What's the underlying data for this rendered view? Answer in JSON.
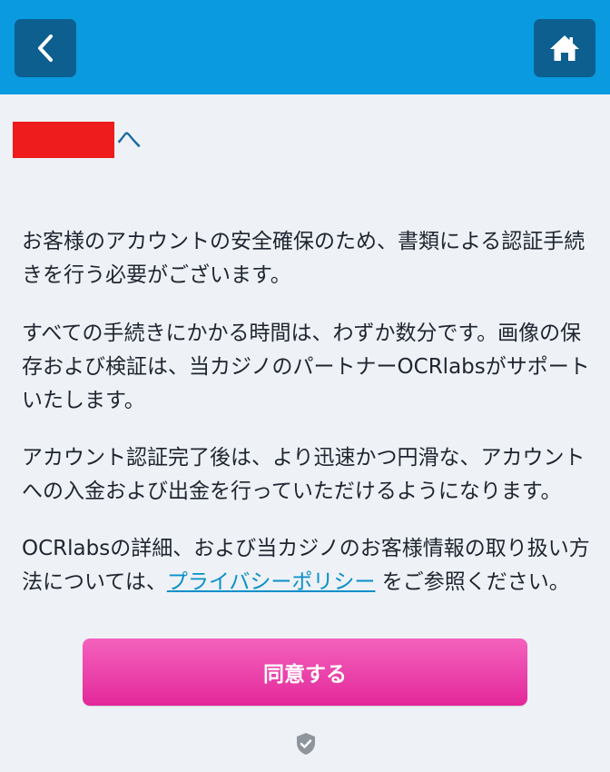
{
  "header": {
    "back_icon": "chevron-left-icon",
    "home_icon": "home-icon",
    "colors": {
      "bar": "#0a9ae0",
      "button": "#0c5f8e"
    }
  },
  "greeting": {
    "suffix": "へ",
    "redaction_color": "#ee1c1c"
  },
  "paragraphs": [
    "お客様のアカウントの安全確保のため、書類による認証手続きを行う必要がございます。",
    "すべての手続きにかかる時間は、わずか数分です。画像の保存および検証は、当カジノのパートナーOCRlabsがサポートいたします。",
    "アカウント認証完了後は、より迅速かつ円滑な、アカウントへの入金および出金を行っていただけるようになります。"
  ],
  "privacy": {
    "before": "OCRlabsの詳細、および当カジノのお客様情報の取り扱い方法については、",
    "link": "プライバシーポリシー",
    "after": " をご参照ください。"
  },
  "agree_button": {
    "label": "同意する",
    "color": "#e3289a"
  },
  "footer": {
    "icon": "shield-check-icon"
  }
}
